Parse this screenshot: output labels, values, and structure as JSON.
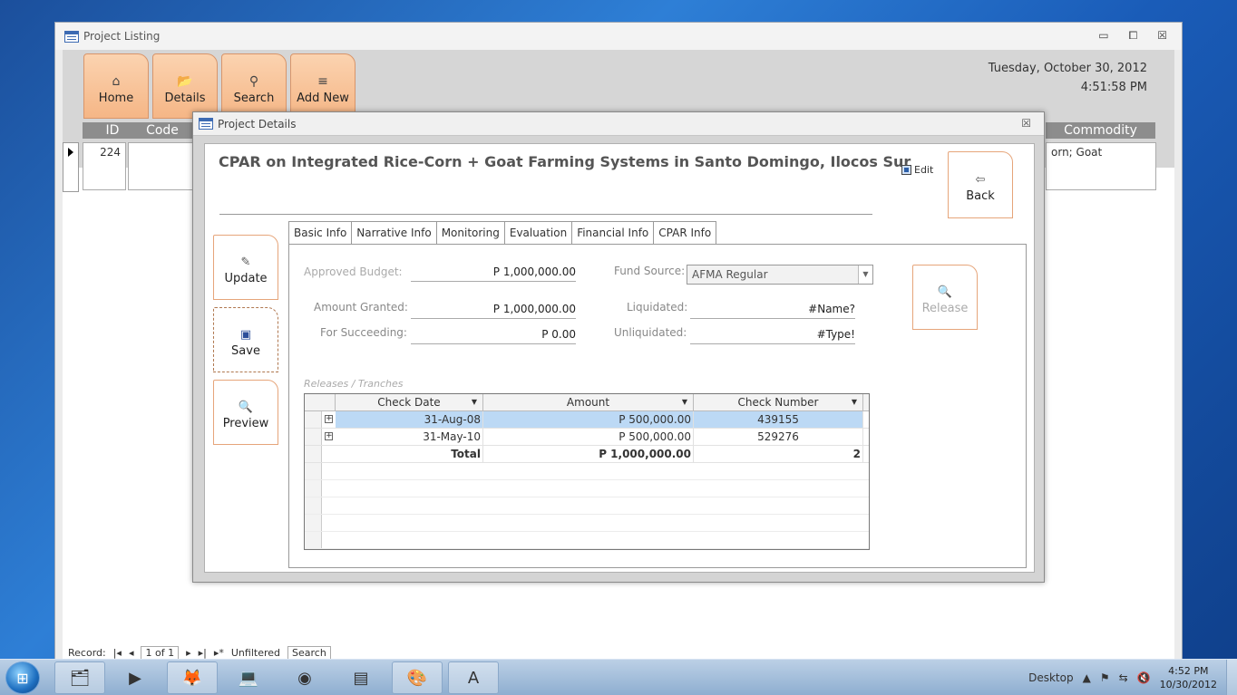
{
  "listing": {
    "title": "Project Listing",
    "controls": {
      "minimize": "▭",
      "restore": "⧠",
      "close": "☒"
    },
    "nav": [
      {
        "label": "Home",
        "icon": "⌂"
      },
      {
        "label": "Details",
        "icon": "📂"
      },
      {
        "label": "Search",
        "icon": "⚲"
      },
      {
        "label": "Add New",
        "icon": "≡"
      }
    ],
    "date": "Tuesday, October 30, 2012",
    "time": "4:51:58 PM",
    "columns": {
      "id": "ID",
      "code": "Code",
      "commodity": "Commodity"
    },
    "record": {
      "id": "224",
      "commodity": "orn; Goat"
    },
    "record_nav": {
      "label": "Record:",
      "first": "|◂",
      "prev": "◂",
      "position": "1 of 1",
      "next": "▸",
      "last": "▸|",
      "new": "▸*",
      "filter": "Unfiltered",
      "search": "Search"
    }
  },
  "details": {
    "title": "Project Details",
    "close": "☒",
    "project_title": "CPAR on Integrated Rice-Corn + Goat Farming Systems in Santo Domingo, Ilocos Sur",
    "edit_label": "Edit",
    "back_label": "Back",
    "side_buttons": {
      "update": "Update",
      "save": "Save",
      "preview": "Preview",
      "release": "Release"
    },
    "tabs": [
      "Basic Info",
      "Narrative Info",
      "Monitoring",
      "Evaluation",
      "Financial Info",
      "CPAR Info"
    ],
    "financial": {
      "approved_budget_label": "Approved Budget:",
      "approved_budget": "P 1,000,000.00",
      "amount_granted_label": "Amount Granted:",
      "amount_granted": "P 1,000,000.00",
      "for_succeeding_label": "For Succeeding:",
      "for_succeeding": "P 0.00",
      "fund_source_label": "Fund Source:",
      "fund_source": "AFMA Regular",
      "liquidated_label": "Liquidated:",
      "liquidated": "#Name?",
      "unliquidated_label": "Unliquidated:",
      "unliquidated": "#Type!"
    },
    "releases": {
      "label": "Releases / Tranches",
      "headers": {
        "date": "Check Date",
        "amount": "Amount",
        "check": "Check Number"
      },
      "rows": [
        {
          "date": "31-Aug-08",
          "amount": "P 500,000.00",
          "check": "439155"
        },
        {
          "date": "31-May-10",
          "amount": "P 500,000.00",
          "check": "529276"
        }
      ],
      "total_label": "Total",
      "total_amount": "P 1,000,000.00",
      "total_count": "2"
    }
  },
  "taskbar": {
    "desktop_label": "Desktop",
    "time": "4:52 PM",
    "date": "10/30/2012"
  }
}
